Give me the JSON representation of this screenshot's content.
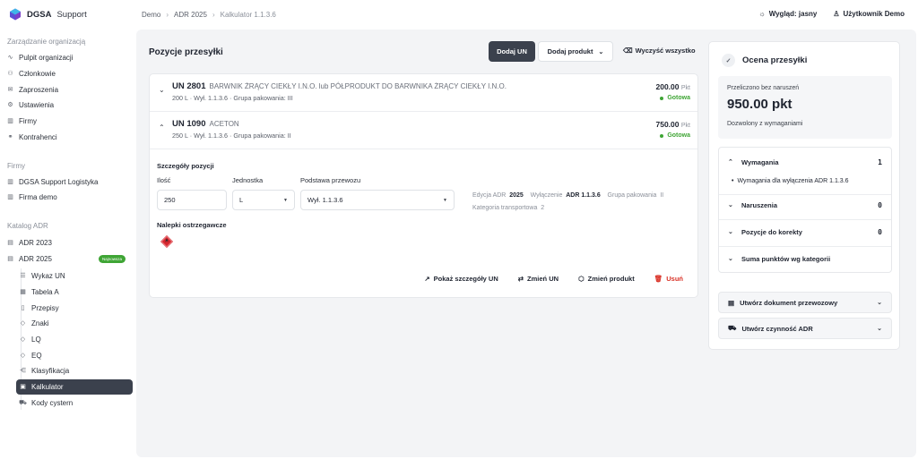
{
  "brand": {
    "name": "DGSA",
    "suffix": "Support"
  },
  "sidebar": {
    "sections": [
      {
        "label": "Zarządzanie organizacją"
      },
      {
        "label": "Firmy"
      },
      {
        "label": "Katalog ADR"
      }
    ],
    "org_items": [
      {
        "label": "Pulpit organizacji",
        "icon": "dashboard-icon"
      },
      {
        "label": "Członkowie",
        "icon": "users-icon"
      },
      {
        "label": "Zaproszenia",
        "icon": "mail-icon"
      },
      {
        "label": "Ustawienia",
        "icon": "gear-icon"
      },
      {
        "label": "Firmy",
        "icon": "building-icon"
      },
      {
        "label": "Kontrahenci",
        "icon": "handshake-icon"
      }
    ],
    "company_items": [
      {
        "label": "DGSA Support Logistyka",
        "icon": "building-icon"
      },
      {
        "label": "Firma demo",
        "icon": "building-icon"
      }
    ],
    "catalog_items": [
      {
        "label": "ADR 2023",
        "icon": "book-icon"
      },
      {
        "label": "ADR 2025",
        "icon": "book-icon",
        "badge": "Najnowsza"
      }
    ],
    "adr_sub_items": [
      {
        "label": "Wykaz UN",
        "icon": "list-icon"
      },
      {
        "label": "Tabela A",
        "icon": "table-icon"
      },
      {
        "label": "Przepisy",
        "icon": "document-icon"
      },
      {
        "label": "Znaki",
        "icon": "diamond-icon"
      },
      {
        "label": "LQ",
        "icon": "diamond-icon"
      },
      {
        "label": "EQ",
        "icon": "diamond-icon"
      },
      {
        "label": "Klasyfikacja",
        "icon": "share-icon"
      },
      {
        "label": "Kalkulator",
        "icon": "calculator-icon",
        "active": true
      },
      {
        "label": "Kody cystern",
        "icon": "truck-icon"
      }
    ]
  },
  "topbar": {
    "crumbs": [
      "Demo",
      "ADR 2025",
      "Kalkulator 1.1.3.6"
    ],
    "theme_label": "Wygląd: jasny",
    "user_label": "Użytkownik Demo"
  },
  "main": {
    "title": "Pozycje przesyłki",
    "add_un": "Dodaj UN",
    "add_product": "Dodaj produkt",
    "clear_all": "Wyczyść wszystko",
    "items": [
      {
        "un": "UN 2801",
        "name": "BARWNIK ŻRĄCY CIEKŁY I.N.O. lub PÓŁPRODUKT DO BARWNIKA ŻRĄCY CIEKŁY I.N.O.",
        "meta": "200 L · Wył. 1.1.3.6 · Grupa pakowania: III",
        "points": "200.00",
        "unit": "Pkt",
        "status": "Gotowa"
      },
      {
        "un": "UN 1090",
        "name": "ACETON",
        "meta": "250 L · Wył. 1.1.3.6 · Grupa pakowania: II",
        "points": "750.00",
        "unit": "Pkt",
        "status": "Gotowa"
      }
    ],
    "details": {
      "title": "Szczegóły pozycji",
      "qty_label": "Ilość",
      "qty_value": "250",
      "unit_label": "Jednostka",
      "unit_value": "L",
      "basis_label": "Podstawa przewozu",
      "basis_value": "Wył. 1.1.3.6",
      "edition_label": "Edycja ADR",
      "edition_value": "2025",
      "exemption_label": "Wyłączenie",
      "exemption_value": "ADR 1.1.3.6",
      "group_label": "Grupa pakowania",
      "group_value": "II",
      "category_label": "Kategoria transportowa",
      "category_value": "2",
      "labels_title": "Nalepki ostrzegawcze"
    },
    "actions": {
      "details": "Pokaż szczegóły UN",
      "change_un": "Zmień UN",
      "change_product": "Zmień produkt",
      "delete": "Usuń"
    }
  },
  "assessment": {
    "title": "Ocena przesyłki",
    "calc_label": "Przeliczono bez naruszeń",
    "score": "950.00 pkt",
    "allowed": "Dozwolony z wymaganiami",
    "sections": [
      {
        "label": "Wymagania",
        "count": "1"
      },
      {
        "label": "Naruszenia",
        "count": "0"
      },
      {
        "label": "Pozycje do korekty",
        "count": "0"
      },
      {
        "label": "Suma punktów wg kategorii"
      }
    ],
    "requirement": "Wymagania dla wyłączenia ADR 1.1.3.6",
    "create_doc": "Utwórz dokument przewozowy",
    "create_action": "Utwórz czynność ADR"
  },
  "colors": {
    "accent_dark": "#3b414d",
    "success": "#3fa535",
    "danger": "#d93025",
    "hazard": "#d7262e"
  }
}
